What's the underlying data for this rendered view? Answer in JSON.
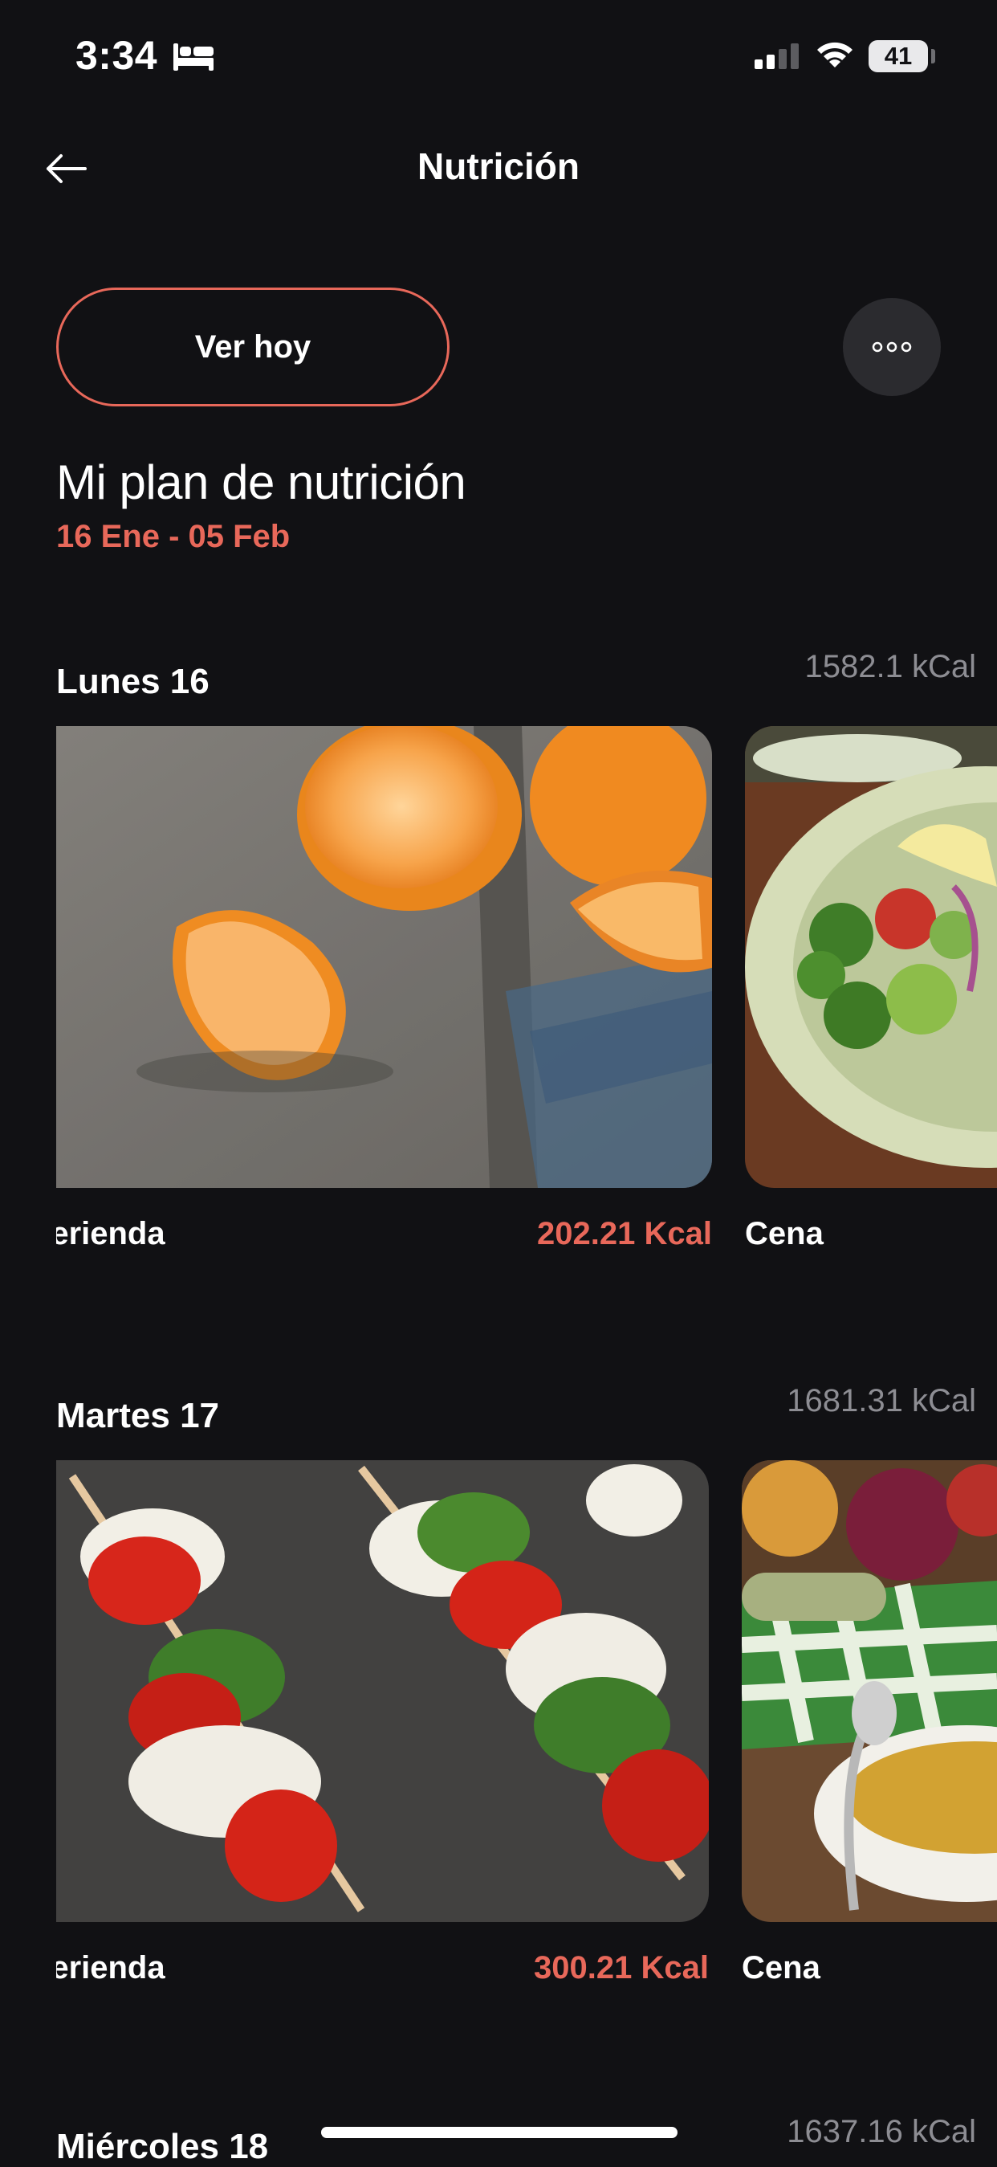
{
  "status_bar": {
    "time": "3:34",
    "battery": "41",
    "icons": [
      "bed-icon",
      "signal-icon",
      "wifi-icon",
      "battery-icon"
    ]
  },
  "header": {
    "title": "Nutrición",
    "back_icon": "arrow-left-icon"
  },
  "actions": {
    "today_label": "Ver hoy",
    "more_icon": "more-dots-icon"
  },
  "plan": {
    "title": "Mi plan de nutrición",
    "date_range": "16 Ene - 05 Feb"
  },
  "days": [
    {
      "name": "Lunes 16",
      "kcal": "1582.1 kCal",
      "meals": [
        {
          "name": "Merienda",
          "kcal": "202.21 Kcal",
          "image": "oranges"
        },
        {
          "name": "Cena",
          "kcal": "",
          "image": "salad"
        }
      ]
    },
    {
      "name": "Martes 17",
      "kcal": "1681.31 kCal",
      "meals": [
        {
          "name": "Merienda",
          "kcal": "300.21 Kcal",
          "image": "caprese-skewers"
        },
        {
          "name": "Cena",
          "kcal": "",
          "image": "vegetable-soup"
        }
      ]
    },
    {
      "name": "Miércoles 18",
      "kcal": "1637.16 kCal"
    }
  ],
  "colors": {
    "background": "#111114",
    "accent": "#e8685a",
    "muted_text": "#8d8d93",
    "circle_button": "#2b2b2f"
  }
}
